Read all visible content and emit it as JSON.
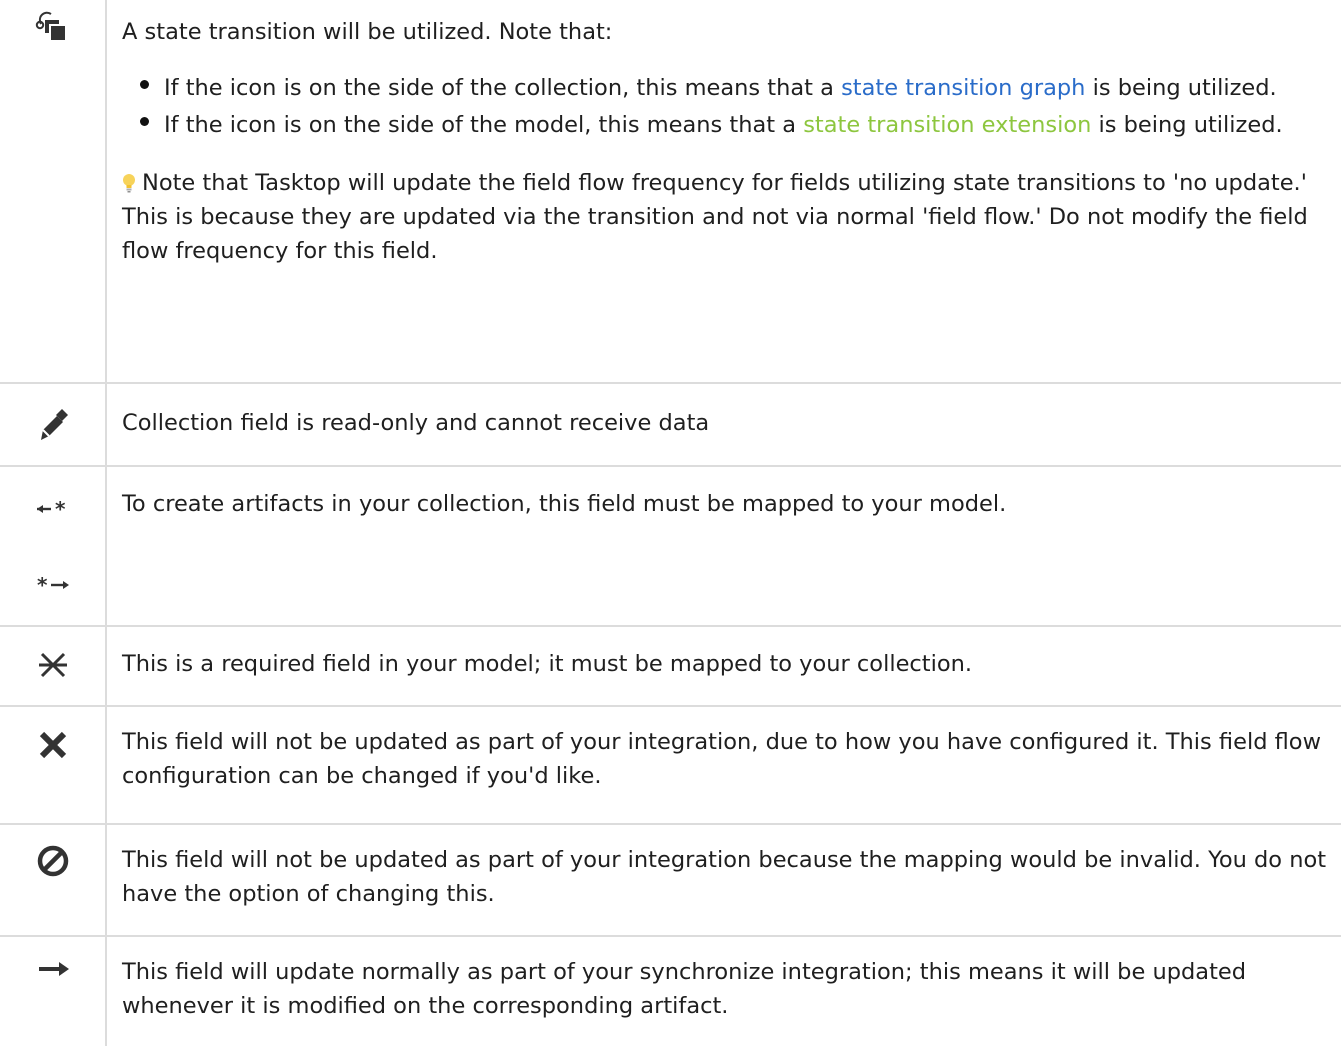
{
  "rows": [
    {
      "icon": "state-transition-icon",
      "intro": "A state transition will be utilized. Note that:",
      "bullets": [
        {
          "before": "If the icon is on the side of the collection, this means that a ",
          "link": "state transition graph",
          "after": " is being utilized."
        },
        {
          "before": "If the icon is on the side of the model, this means that a ",
          "link": "state transition extension",
          "after": " is being utilized."
        }
      ],
      "note": "Note that Tasktop will update the field flow frequency for fields utilizing state transitions to 'no update.' This is because they are updated via the transition and not via normal 'field flow.' Do not modify the field flow frequency for this field."
    },
    {
      "icon": "no-edit-pencil-icon",
      "text": "Collection field is read-only and cannot receive data"
    },
    {
      "icon": "required-mapping-arrows-icon",
      "text": "To create artifacts in your collection, this field must be mapped to your model."
    },
    {
      "icon": "asterisk-icon",
      "text": "This is a required field in your model; it must be mapped to your collection."
    },
    {
      "icon": "x-icon",
      "text": "This field will not be updated as part of your integration, due to how you have configured it. This field flow configuration can be changed if you'd like."
    },
    {
      "icon": "prohibited-icon",
      "text": "This field will not be updated as part of your integration because the mapping would be invalid. You do not have the option of changing this."
    },
    {
      "icon": "right-arrow-icon",
      "text": "This field will update normally as part of your synchronize integration; this means it will be updated whenever it is modified on the corresponding artifact."
    }
  ],
  "colors": {
    "link_graph": "#2a6cc9",
    "link_extension": "#8dc63f",
    "border": "#dcdcdc",
    "icon": "#333333"
  }
}
